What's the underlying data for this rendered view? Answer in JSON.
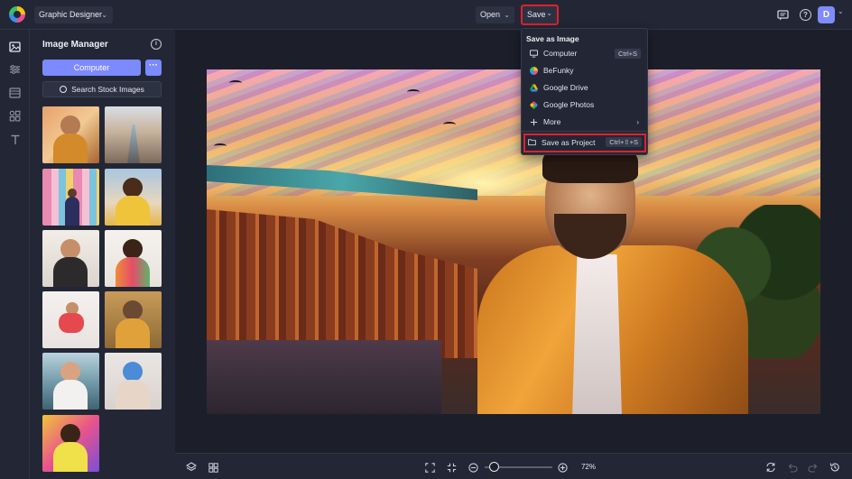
{
  "topbar": {
    "project_name": "Graphic Designer",
    "open_label": "Open",
    "save_label": "Save",
    "user_initial": "D"
  },
  "panel": {
    "title": "Image Manager",
    "computer_label": "Computer",
    "more_label": "···",
    "stock_label": "Search Stock Images"
  },
  "save_menu": {
    "header": "Save as Image",
    "items": [
      {
        "label": "Computer",
        "shortcut": "Ctrl+S",
        "icon": "monitor-icon"
      },
      {
        "label": "BeFunky",
        "shortcut": "",
        "icon": "befunky-icon"
      },
      {
        "label": "Google Drive",
        "shortcut": "",
        "icon": "google-drive-icon"
      },
      {
        "label": "Google Photos",
        "shortcut": "",
        "icon": "google-photos-icon"
      },
      {
        "label": "More",
        "shortcut": "",
        "icon": "plus-icon"
      }
    ],
    "project_item": {
      "label": "Save as Project",
      "shortcut": "Ctrl+⇧+S",
      "icon": "folder-icon"
    }
  },
  "zoom": {
    "value": "72%"
  },
  "colors": {
    "accent": "#7c8aff",
    "highlight_red": "#e0202e",
    "panel_bg": "#232735",
    "workspace_bg": "#1c1f2a"
  }
}
